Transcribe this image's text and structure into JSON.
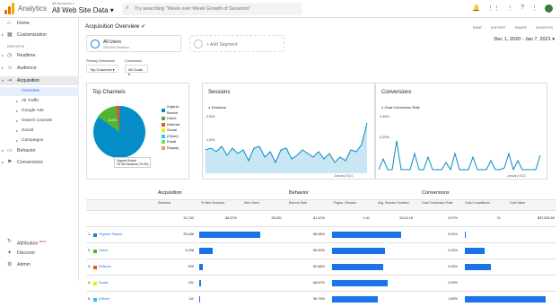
{
  "app": {
    "name": "Analytics",
    "account_small": "All accounts >",
    "account_big": "All Web Site Data ▾"
  },
  "search": {
    "placeholder": "Try searching \"Week over Week Growth of Sessions\""
  },
  "sidebar": {
    "home": "Home",
    "customization": "Customization",
    "reports": "REPORTS",
    "realtime": "Realtime",
    "audience": "Audience",
    "acquisition": "Acquisition",
    "sub": [
      "Overview",
      "All Traffic",
      "Google Ads",
      "Search Console",
      "Social",
      "Campaigns"
    ],
    "behavior": "Behavior",
    "conversions": "Conversions",
    "attribution": "Attribution",
    "beta": "BETA",
    "discover": "Discover",
    "admin": "Admin"
  },
  "report": {
    "title": "Acquisition Overview",
    "actions": [
      "SAVE",
      "EXPORT",
      "SHARE",
      "INSIGHTS"
    ],
    "date_range": "Dec 1, 2020 - Jan 7, 2021",
    "segment": {
      "name": "All Users",
      "sub": "100.00% Sessions"
    },
    "add_segment": "+ Add Segment",
    "primary_dimension_label": "Primary Dimension",
    "conversion_label": "Conversion",
    "primary_dimension": "Top Channels ▾",
    "conversion": "All Goals ▾"
  },
  "cards": {
    "top_channels": "Top Channels",
    "sessions": "Sessions",
    "conversions": "Conversions"
  },
  "legend": [
    {
      "name": "Organic Search",
      "color": "#058dc7"
    },
    {
      "name": "Direct",
      "color": "#50b432"
    },
    {
      "name": "Referral",
      "color": "#ed561b"
    },
    {
      "name": "Social",
      "color": "#edef00"
    },
    {
      "name": "(Other)",
      "color": "#24cbe5"
    },
    {
      "name": "Email",
      "color": "#64e572"
    },
    {
      "name": "Display",
      "color": "#ff9655"
    }
  ],
  "pie": {
    "label1": "Organic Search",
    "label2": "25.78k Sessions (79.3%)",
    "pct_direct": "16.4%"
  },
  "sessions_chart": {
    "legend": "Sessions",
    "y_top": "2,000",
    "y_mid": "1,000",
    "x_label": "January 2021"
  },
  "conversions_chart": {
    "legend": "Goal Conversion Rate",
    "y_top": "0.40%",
    "y_mid": "0.20%",
    "x_label": "January 2021"
  },
  "table": {
    "groups": [
      "Acquisition",
      "Behavior",
      "Conversions"
    ],
    "headers": [
      "Sessions",
      "% New Sessions",
      "New Users",
      "Bounce Rate",
      "Pages / Session",
      "Avg. Session Duration",
      "Goal Conversion Rate",
      "Goal Completions",
      "Goal Value"
    ],
    "totals": [
      "31,742",
      "88.37%",
      "28,051",
      "81.42%",
      "1.41",
      "00:01:16",
      "0.07%",
      "21",
      "$37,500.00"
    ],
    "rows": [
      {
        "idx": "1.",
        "name": "Organic Search",
        "color": "#058dc7",
        "sessions": "25,186",
        "bounce": "85.58%",
        "conv": "0.01%"
      },
      {
        "idx": "2.",
        "name": "Direct",
        "color": "#50b432",
        "sessions": "5,208",
        "bounce": "65.90%",
        "conv": "0.24%"
      },
      {
        "idx": "3.",
        "name": "Referral",
        "color": "#ed561b",
        "sessions": "929",
        "bounce": "62.86%",
        "conv": "0.32%"
      },
      {
        "idx": "4.",
        "name": "Social",
        "color": "#edef00",
        "sessions": "151",
        "bounce": "68.87%",
        "conv": "0.00%"
      },
      {
        "idx": "5.",
        "name": "(Other)",
        "color": "#24cbe5",
        "sessions": "111",
        "bounce": "56.76%",
        "conv": "1.80%"
      }
    ]
  }
}
